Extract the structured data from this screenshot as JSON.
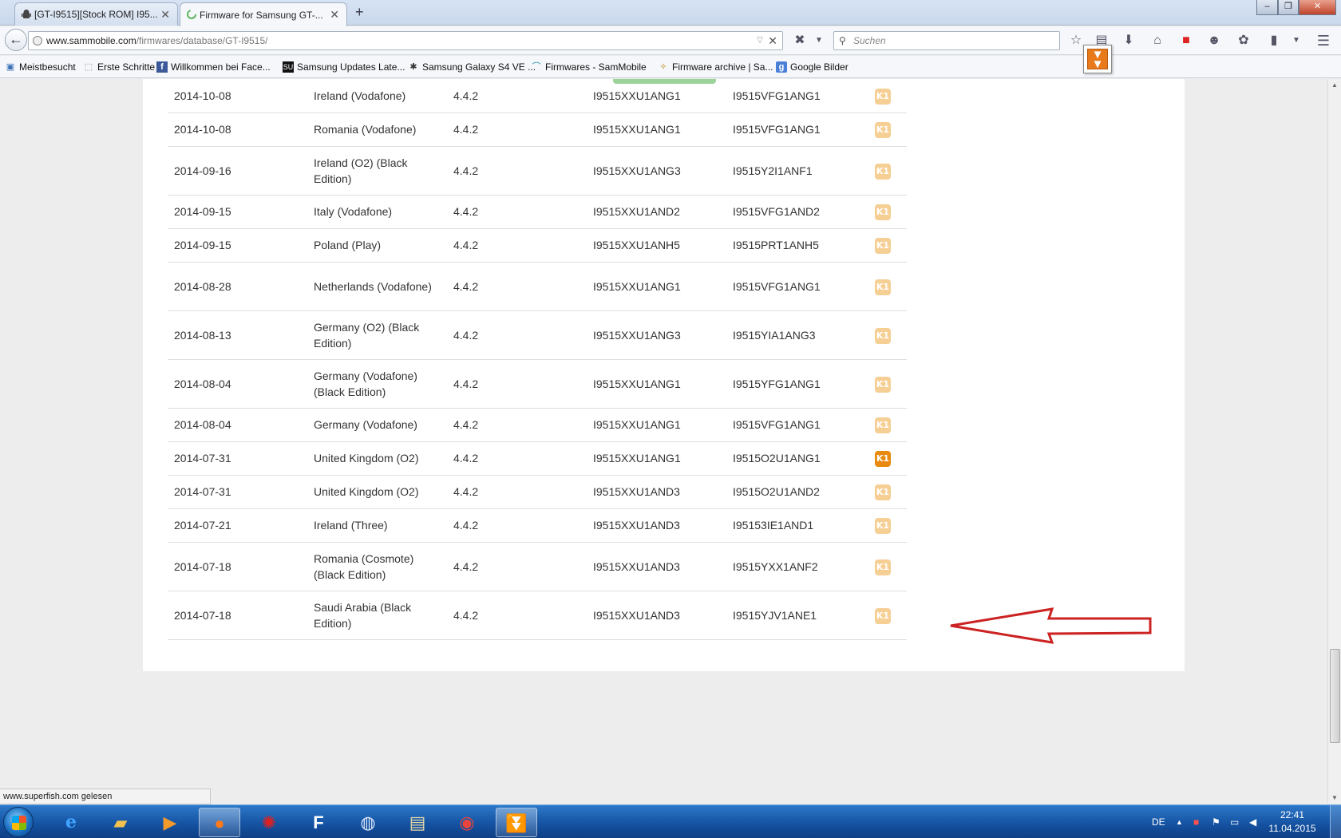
{
  "browser": {
    "tabs": [
      {
        "title": "[GT-I9515][Stock ROM] I95...",
        "active": false,
        "icon": "android-icon"
      },
      {
        "title": "Firmware for Samsung GT-...",
        "active": true,
        "icon": "loading-spinner-icon"
      }
    ],
    "new_tab_label": "+",
    "window_controls": [
      "–",
      "❐",
      "✕"
    ],
    "url_host": "www.sammobile.com",
    "url_path": "/firmwares/database/GT-I9515/",
    "search_placeholder": "Suchen",
    "bookmarks": [
      "Meistbesucht",
      "Erste Schritte",
      "Willkommen bei Face...",
      "Samsung Updates Late...",
      "Samsung Galaxy S4 VE ...",
      "Firmwares - SamMobile",
      "Firmware archive | Sa...",
      "Google Bilder"
    ],
    "status_text": "www.superfish.com gelesen"
  },
  "firmware_table": {
    "knox_label": "K1",
    "rows": [
      {
        "date": "2014-10-08",
        "country": "Ireland (Vodafone)",
        "version": "4.4.2",
        "pda": "I9515XXU1ANG1",
        "csc": "I9515VFG1ANG1",
        "knox_highlight": false
      },
      {
        "date": "2014-10-08",
        "country": "Romania (Vodafone)",
        "version": "4.4.2",
        "pda": "I9515XXU1ANG1",
        "csc": "I9515VFG1ANG1",
        "knox_highlight": false
      },
      {
        "date": "2014-09-16",
        "country": "Ireland (O2) (Black Edition)",
        "version": "4.4.2",
        "pda": "I9515XXU1ANG3",
        "csc": "I9515Y2I1ANF1",
        "knox_highlight": false
      },
      {
        "date": "2014-09-15",
        "country": "Italy (Vodafone)",
        "version": "4.4.2",
        "pda": "I9515XXU1AND2",
        "csc": "I9515VFG1AND2",
        "knox_highlight": false
      },
      {
        "date": "2014-09-15",
        "country": "Poland (Play)",
        "version": "4.4.2",
        "pda": "I9515XXU1ANH5",
        "csc": "I9515PRT1ANH5",
        "knox_highlight": false
      },
      {
        "date": "2014-08-28",
        "country": "Netherlands (Vodafone)",
        "version": "4.4.2",
        "pda": "I9515XXU1ANG1",
        "csc": "I9515VFG1ANG1",
        "knox_highlight": false
      },
      {
        "date": "2014-08-13",
        "country": "Germany (O2) (Black Edition)",
        "version": "4.4.2",
        "pda": "I9515XXU1ANG3",
        "csc": "I9515YIA1ANG3",
        "knox_highlight": false
      },
      {
        "date": "2014-08-04",
        "country": "Germany (Vodafone) (Black Edition)",
        "version": "4.4.2",
        "pda": "I9515XXU1ANG1",
        "csc": "I9515YFG1ANG1",
        "knox_highlight": false
      },
      {
        "date": "2014-08-04",
        "country": "Germany (Vodafone)",
        "version": "4.4.2",
        "pda": "I9515XXU1ANG1",
        "csc": "I9515VFG1ANG1",
        "knox_highlight": false
      },
      {
        "date": "2014-07-31",
        "country": "United Kingdom (O2)",
        "version": "4.4.2",
        "pda": "I9515XXU1ANG1",
        "csc": "I9515O2U1ANG1",
        "knox_highlight": true
      },
      {
        "date": "2014-07-31",
        "country": "United Kingdom (O2)",
        "version": "4.4.2",
        "pda": "I9515XXU1AND3",
        "csc": "I9515O2U1AND2",
        "knox_highlight": false
      },
      {
        "date": "2014-07-21",
        "country": "Ireland (Three)",
        "version": "4.4.2",
        "pda": "I9515XXU1AND3",
        "csc": "I95153IE1AND1",
        "knox_highlight": false
      },
      {
        "date": "2014-07-18",
        "country": "Romania (Cosmote) (Black Edition)",
        "version": "4.4.2",
        "pda": "I9515XXU1AND3",
        "csc": "I9515YXX1ANF2",
        "knox_highlight": false
      },
      {
        "date": "2014-07-18",
        "country": "Saudi Arabia (Black Edition)",
        "version": "4.4.2",
        "pda": "I9515XXU1AND3",
        "csc": "I9515YJV1ANE1",
        "knox_highlight": false
      }
    ]
  },
  "taskbar": {
    "apps": [
      "internet-explorer-icon",
      "explorer-folder-icon",
      "media-player-icon",
      "firefox-icon",
      "paint-splash-icon",
      "flash-app-icon",
      "globe-network-icon",
      "files-icon",
      "chrome-icon",
      "downloader-icon"
    ],
    "language": "DE",
    "time": "22:41",
    "date": "11.04.2015"
  },
  "colors": {
    "knox_light": "#f6cf95",
    "knox_strong": "#e88a10",
    "arrow_red": "#cc2222"
  }
}
